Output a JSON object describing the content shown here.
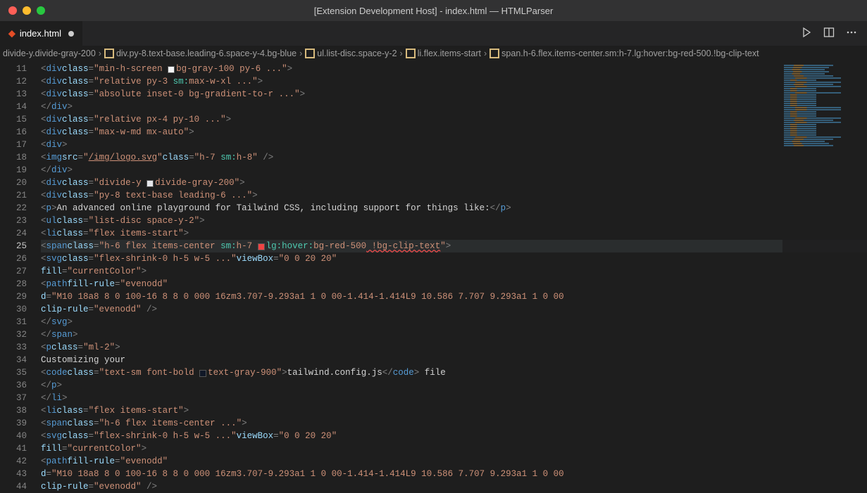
{
  "window": {
    "title": "[Extension Development Host] - index.html — HTMLParser"
  },
  "tab": {
    "filename": "index.html"
  },
  "breadcrumbs": {
    "items": [
      "divide-y.divide-gray-200",
      "div.py-8.text-base.leading-6.space-y-4.bg-blue",
      "ul.list-disc.space-y-2",
      "li.flex.items-start",
      "span.h-6.flex.items-center.sm:h-7.lg:hover:bg-red-500.!bg-clip-text"
    ]
  },
  "gutter": {
    "start": 11,
    "end": 44,
    "active": 25
  },
  "code": {
    "l11": {
      "tag": "div",
      "attr": "class",
      "value": "min-h-screen ",
      "value2": "bg-gray-100 py-6 ...",
      "swatch": "sw-white"
    },
    "l12": {
      "tag": "div",
      "attr": "class",
      "value": "relative py-3 ",
      "pf": "sm:",
      "value2": "max-w-xl ..."
    },
    "l13": {
      "tag": "div",
      "attr": "class",
      "value": "absolute inset-0 bg-gradient-to-r ..."
    },
    "l14": {
      "tag": "div"
    },
    "l15": {
      "tag": "div",
      "attr": "class",
      "value": "relative px-4 py-10 ..."
    },
    "l16": {
      "tag": "div",
      "attr": "class",
      "value": "max-w-md mx-auto"
    },
    "l17": {
      "tag": "div"
    },
    "l18": {
      "tag": "img",
      "src": "/img/logo.svg",
      "attr": "class",
      "value": "h-7 ",
      "pf": "sm:",
      "value2": "h-8"
    },
    "l19": {
      "tag": "div"
    },
    "l20": {
      "tag": "div",
      "attr": "class",
      "value": "divide-y ",
      "value2": "divide-gray-200",
      "swatch": "sw-gray2"
    },
    "l21": {
      "tag": "div",
      "attr": "class",
      "value": "py-8 text-base leading-6 ..."
    },
    "l22": {
      "tag": "p",
      "text": "An advanced online playground for Tailwind CSS, including support for things like:"
    },
    "l23": {
      "tag": "ul",
      "attr": "class",
      "value": "list-disc space-y-2"
    },
    "l24": {
      "tag": "li",
      "attr": "class",
      "value": "flex items-start"
    },
    "l25": {
      "tag": "span",
      "attr": "class",
      "value": "h-6 flex items-center ",
      "pf": "sm:",
      "value2": "h-7 ",
      "pf2": "lg:hover:",
      "value3": "bg-red-500",
      "err": " !bg-clip-text",
      "swatch": "sw-red"
    },
    "l26": {
      "tag": "svg",
      "attr": "class",
      "value": "flex-shrink-0 h-5 w-5 ...",
      "vb": "0 0 20 20"
    },
    "l27": {
      "attr": "fill",
      "value": "currentColor"
    },
    "l28": {
      "tag": "path",
      "attr": "fill-rule",
      "value": "evenodd"
    },
    "l29": {
      "attr": "d",
      "value": "M10 18a8 8 0 100-16 8 8 0 000 16zm3.707-9.293a1 1 0 00-1.414-1.414L9 10.586 7.707 9.293a1 1 0 00"
    },
    "l30": {
      "attr": "clip-rule",
      "value": "evenodd"
    },
    "l31": {
      "tag": "svg"
    },
    "l32": {
      "tag": "span"
    },
    "l33": {
      "tag": "p",
      "attr": "class",
      "value": "ml-2"
    },
    "l34": {
      "text": "Customizing your"
    },
    "l35": {
      "tag": "code",
      "attr": "class",
      "value": "text-sm font-bold ",
      "value2": "text-gray-900",
      "text": "tailwind.config.js",
      "after": " file",
      "swatch": "sw-gray9"
    },
    "l36": {
      "tag": "p"
    },
    "l37": {
      "tag": "li"
    },
    "l38": {
      "tag": "li",
      "attr": "class",
      "value": "flex items-start"
    },
    "l39": {
      "tag": "span",
      "attr": "class",
      "value": "h-6 flex items-center ..."
    },
    "l40": {
      "tag": "svg",
      "attr": "class",
      "value": "flex-shrink-0 h-5 w-5 ...",
      "vb": "0 0 20 20"
    },
    "l41": {
      "attr": "fill",
      "value": "currentColor"
    },
    "l42": {
      "tag": "path",
      "attr": "fill-rule",
      "value": "evenodd"
    },
    "l43": {
      "attr": "d",
      "value": "M10 18a8 8 0 100-16 8 8 0 000 16zm3.707-9.293a1 1 0 00-1.414-1.414L9 10.586 7.707 9.293a1 1 0 00"
    },
    "l44": {
      "attr": "clip-rule",
      "value": "evenodd"
    }
  }
}
